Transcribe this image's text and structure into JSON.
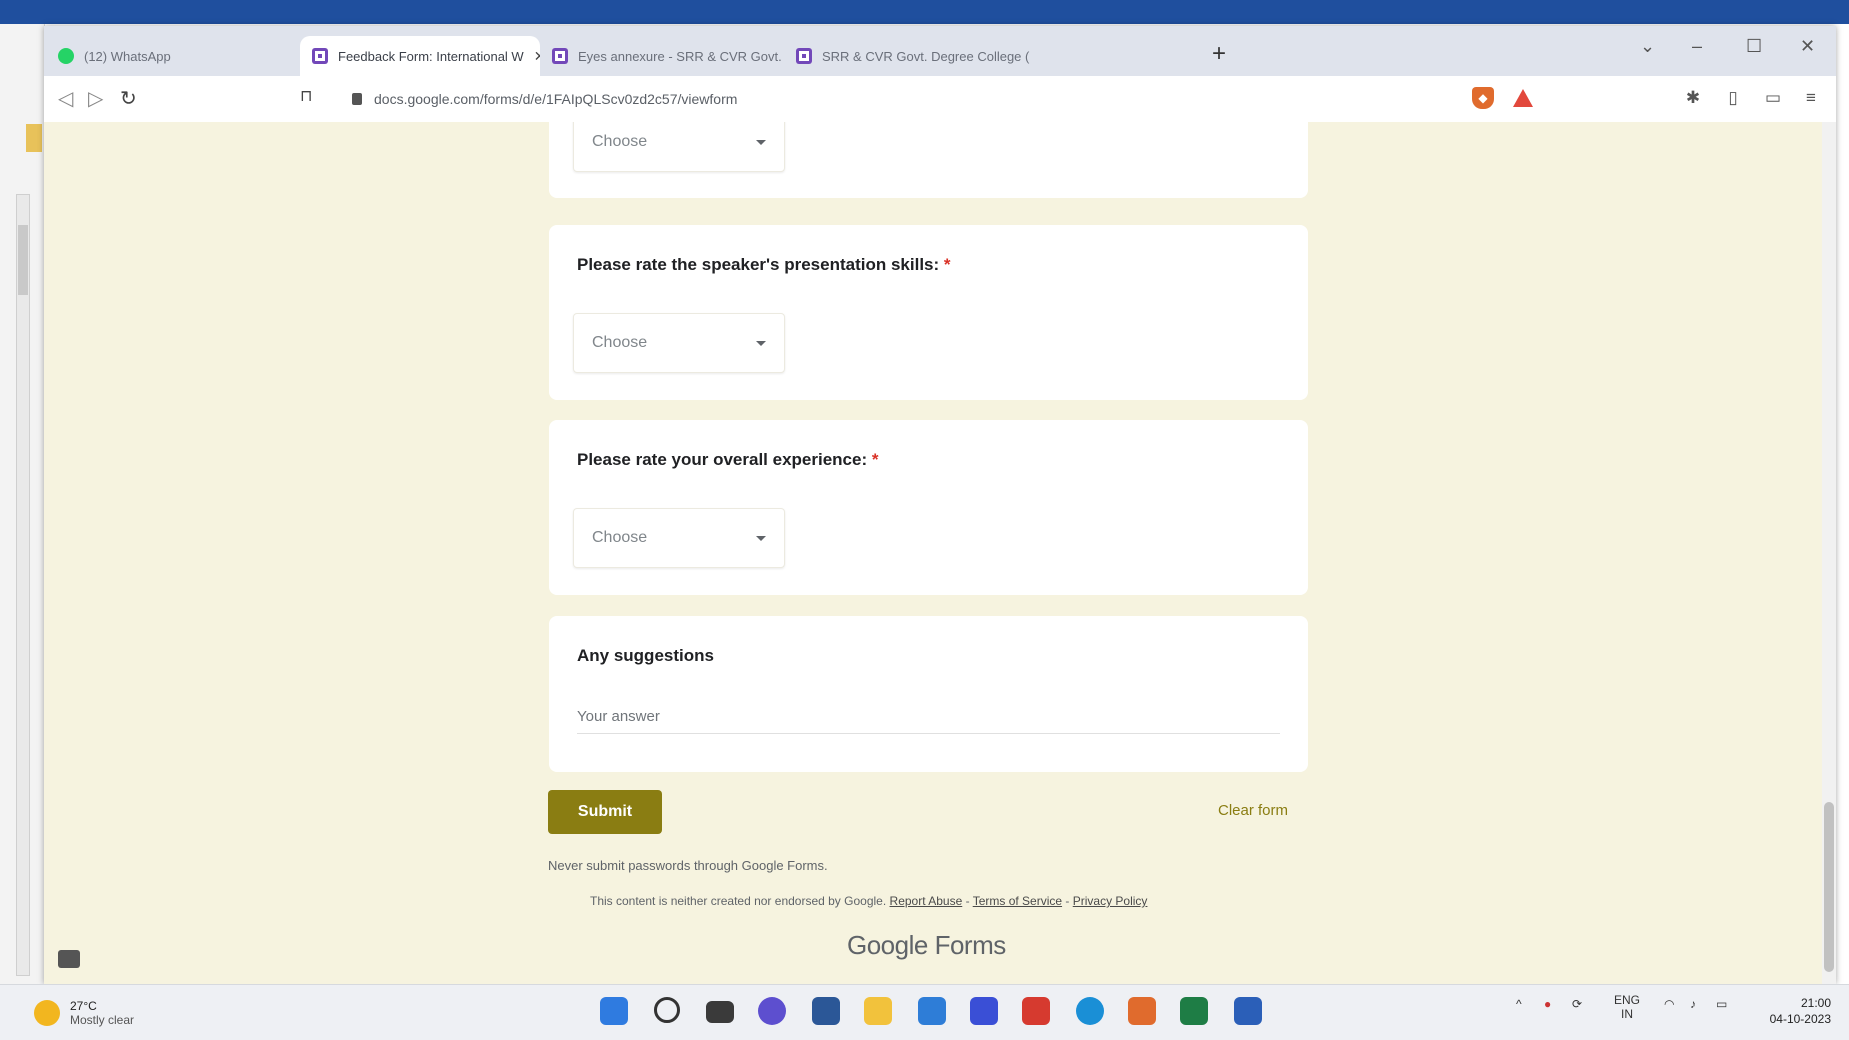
{
  "browser": {
    "tabs": [
      {
        "label": "(12) WhatsApp",
        "icon": "whatsapp-icon"
      },
      {
        "label": "Feedback Form: International W",
        "icon": "forms-icon",
        "active": true
      },
      {
        "label": "Eyes annexure - SRR & CVR Govt. De",
        "icon": "forms-icon"
      },
      {
        "label": "SRR & CVR Govt. Degree College (",
        "icon": "forms-icon"
      }
    ],
    "new_tab": "+",
    "url": "docs.google.com/forms/d/e/1FAIpQLScv0zd2c57/viewform"
  },
  "form": {
    "top_select_value": "Choose",
    "questions": [
      {
        "title": "Please rate the speaker's presentation skills:",
        "required_mark": "*",
        "select_value": "Choose"
      },
      {
        "title": "Please rate your overall experience:",
        "required_mark": "*",
        "select_value": "Choose"
      }
    ],
    "suggestions": {
      "title": "Any suggestions",
      "placeholder": "Your answer"
    },
    "submit_label": "Submit",
    "clear_label": "Clear form",
    "never_submit": "Never submit passwords through Google Forms.",
    "disclaimer": "This content is neither created nor endorsed by Google.",
    "links": [
      "Report Abuse",
      "Terms of Service",
      "Privacy Policy"
    ],
    "brand": {
      "google": "Google",
      "forms": "Forms"
    }
  },
  "taskbar": {
    "weather_temp": "27°C",
    "weather_desc": "Mostly clear",
    "lang_line1": "ENG",
    "lang_line2": "IN",
    "time": "21:00",
    "date": "04-10-2023"
  },
  "colors": {
    "accent": "#8a7d12",
    "page_bg": "#f6f3df"
  }
}
